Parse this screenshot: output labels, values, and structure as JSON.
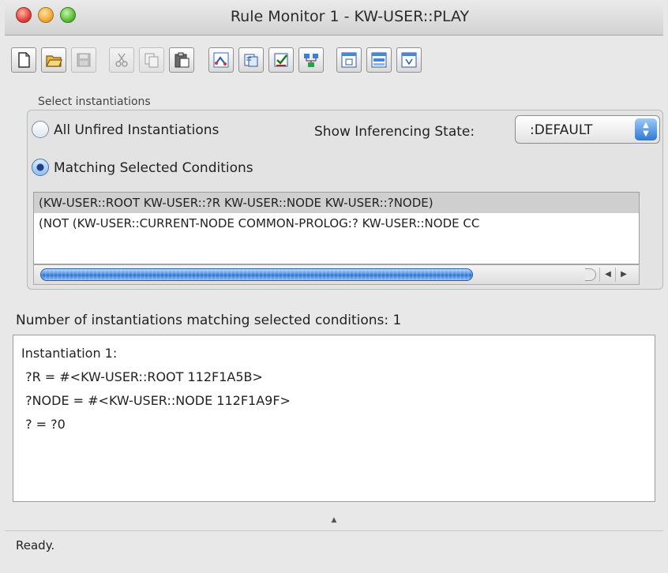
{
  "window": {
    "title": "Rule Monitor 1 - KW-USER::PLAY"
  },
  "toolbar": [
    {
      "name": "new-document-icon",
      "enabled": true
    },
    {
      "name": "open-folder-icon",
      "enabled": true
    },
    {
      "name": "save-disk-icon",
      "enabled": false
    },
    {
      "name": "cut-scissors-icon",
      "enabled": false
    },
    {
      "name": "copy-icon",
      "enabled": false
    },
    {
      "name": "paste-clipboard-icon",
      "enabled": true
    },
    {
      "name": "rule-graph-icon",
      "enabled": true
    },
    {
      "name": "instantiate-icon",
      "enabled": true
    },
    {
      "name": "check-edit-icon",
      "enabled": true
    },
    {
      "name": "network-icon",
      "enabled": true
    },
    {
      "name": "window-restore-icon",
      "enabled": true
    },
    {
      "name": "window-split-icon",
      "enabled": true
    },
    {
      "name": "window-frame-icon",
      "enabled": true
    }
  ],
  "selection": {
    "group_label": "Select instantiations",
    "option_all": "All Unfired Instantiations",
    "option_matching": "Matching Selected Conditions",
    "selected": "matching",
    "inferencing_label": "Show Inferencing State:",
    "inferencing_value": ":DEFAULT",
    "conditions": [
      "(KW-USER::ROOT KW-USER::?R KW-USER::NODE KW-USER::?NODE)",
      "(NOT (KW-USER::CURRENT-NODE COMMON-PROLOG:? KW-USER::NODE CC"
    ],
    "selected_condition": 0
  },
  "results": {
    "count_text": "Number of instantiations matching selected conditions: 1",
    "lines": [
      "Instantiation 1:",
      " ?R = #<KW-USER::ROOT 112F1A5B>",
      " ?NODE = #<KW-USER::NODE 112F1A9F>",
      " ? = ?0"
    ]
  },
  "status": {
    "text": "Ready."
  },
  "colors": {
    "accent": "#2f78d6",
    "window_bg": "#e8e8e8",
    "selection_row": "#cfcfcf"
  }
}
